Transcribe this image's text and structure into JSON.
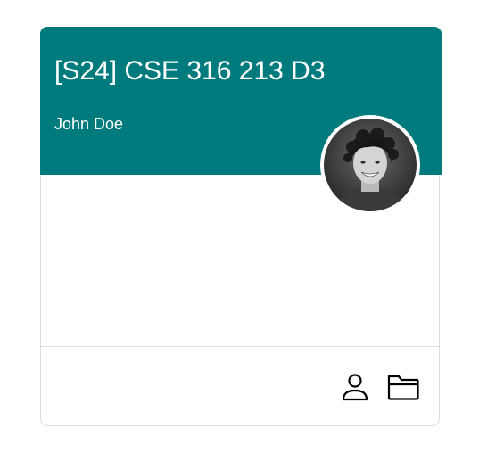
{
  "course_card": {
    "title": "[S24] CSE 316 213 D3",
    "teacher": "John Doe",
    "header_color": "#007b7d",
    "avatar_icon": "teacher-avatar-photo",
    "footer": {
      "people_icon": "person-icon",
      "folder_icon": "folder-icon"
    }
  }
}
